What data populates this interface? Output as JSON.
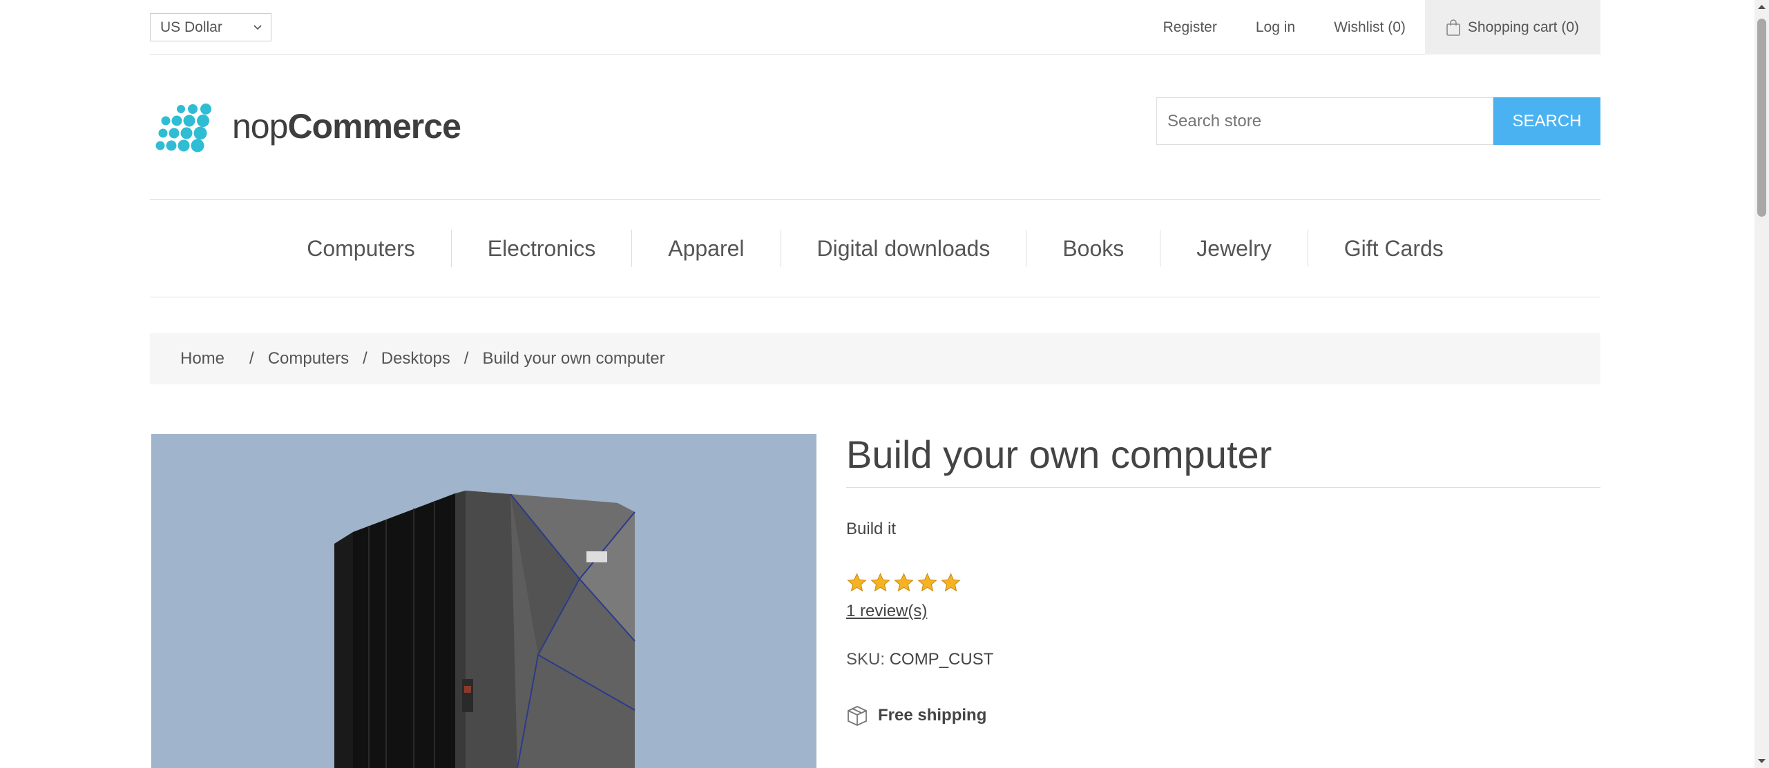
{
  "header": {
    "currency": "US Dollar",
    "links": {
      "register": "Register",
      "login": "Log in",
      "wishlist": "Wishlist (0)",
      "cart": "Shopping cart (0)"
    }
  },
  "logo": {
    "light": "nop",
    "bold": "Commerce"
  },
  "search": {
    "placeholder": "Search store",
    "button": "SEARCH"
  },
  "menu": {
    "items": [
      "Computers",
      "Electronics",
      "Apparel",
      "Digital downloads",
      "Books",
      "Jewelry",
      "Gift Cards"
    ]
  },
  "breadcrumb": {
    "home": "Home",
    "computers": "Computers",
    "desktops": "Desktops",
    "current": "Build your own computer",
    "separator": "/"
  },
  "product": {
    "title": "Build your own computer",
    "short_description": "Build it",
    "rating": 5,
    "rating_max": 5,
    "reviews": "1 review(s)",
    "sku_label": "SKU:",
    "sku_value": "COMP_CUST",
    "shipping": "Free shipping"
  },
  "colors": {
    "accent": "#4ab2f1",
    "logo_dots": "#2fbdd4",
    "image_bg": "#a0b4cb",
    "star": "#f5b223"
  }
}
